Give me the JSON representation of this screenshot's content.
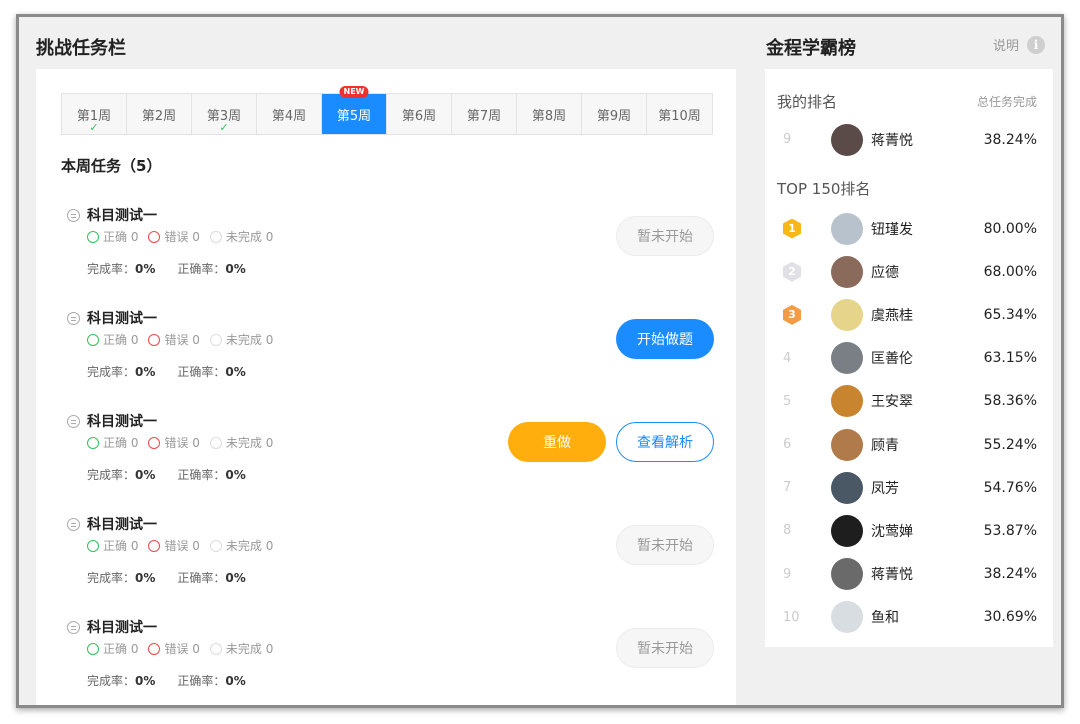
{
  "header": {
    "left_title": "挑战任务栏",
    "right_title": "金程学霸榜",
    "help_label": "说明",
    "help_icon": "info-icon"
  },
  "weeks": [
    {
      "label": "第1周",
      "checked": true
    },
    {
      "label": "第2周",
      "checked": false
    },
    {
      "label": "第3周",
      "checked": true
    },
    {
      "label": "第4周",
      "checked": false
    },
    {
      "label": "第5周",
      "active": true,
      "badge": "NEW"
    },
    {
      "label": "第6周"
    },
    {
      "label": "第7周"
    },
    {
      "label": "第8周"
    },
    {
      "label": "第9周"
    },
    {
      "label": "第10周"
    }
  ],
  "week_check_mark": "✓",
  "task_heading": "本周任务（5）",
  "stat_labels": {
    "correct": "正确 0",
    "wrong": "错误 0",
    "unfinished": "未完成 0",
    "completion": "完成率：",
    "accuracy": "正确率："
  },
  "tasks": [
    {
      "title": "科目测试一",
      "completion": "0%",
      "accuracy": "0%",
      "buttons": [
        {
          "label": "暂未开始",
          "style": "disabled"
        }
      ]
    },
    {
      "title": "科目测试一",
      "completion": "0%",
      "accuracy": "0%",
      "buttons": [
        {
          "label": "开始做题",
          "style": "primary"
        }
      ]
    },
    {
      "title": "科目测试一",
      "completion": "0%",
      "accuracy": "0%",
      "buttons": [
        {
          "label": "重做",
          "style": "orange"
        },
        {
          "label": "查看解析",
          "style": "outline"
        }
      ]
    },
    {
      "title": "科目测试一",
      "completion": "0%",
      "accuracy": "0%",
      "buttons": [
        {
          "label": "暂未开始",
          "style": "disabled"
        }
      ]
    },
    {
      "title": "科目测试一",
      "completion": "0%",
      "accuracy": "0%",
      "buttons": [
        {
          "label": "暂未开始",
          "style": "disabled"
        }
      ]
    }
  ],
  "ranking": {
    "my_rank_label": "我的排名",
    "total_label": "总任务完成",
    "top_label": "TOP 150排名",
    "me": {
      "rank": "9",
      "name": "蒋菁悦",
      "percent": "38.24%"
    },
    "top": [
      {
        "rank": "1",
        "medal": "gold",
        "name": "钮瑾发",
        "percent": "80.00%"
      },
      {
        "rank": "2",
        "medal": "silver",
        "name": "应德",
        "percent": "68.00%"
      },
      {
        "rank": "3",
        "medal": "bronze",
        "name": "虞燕桂",
        "percent": "65.34%"
      },
      {
        "rank": "4",
        "name": "匡善伦",
        "percent": "63.15%"
      },
      {
        "rank": "5",
        "name": "王安翠",
        "percent": "58.36%"
      },
      {
        "rank": "6",
        "name": "顾青",
        "percent": "55.24%"
      },
      {
        "rank": "7",
        "name": "凤芳",
        "percent": "54.76%"
      },
      {
        "rank": "8",
        "name": "沈莺婵",
        "percent": "53.87%"
      },
      {
        "rank": "9",
        "name": "蒋菁悦",
        "percent": "38.24%"
      },
      {
        "rank": "10",
        "name": "鱼和",
        "percent": "30.69%"
      }
    ]
  },
  "colors": {
    "accent": "#1a8cff",
    "orange": "#ffae0d",
    "correct": "#33c15c",
    "wrong": "#f04848"
  }
}
